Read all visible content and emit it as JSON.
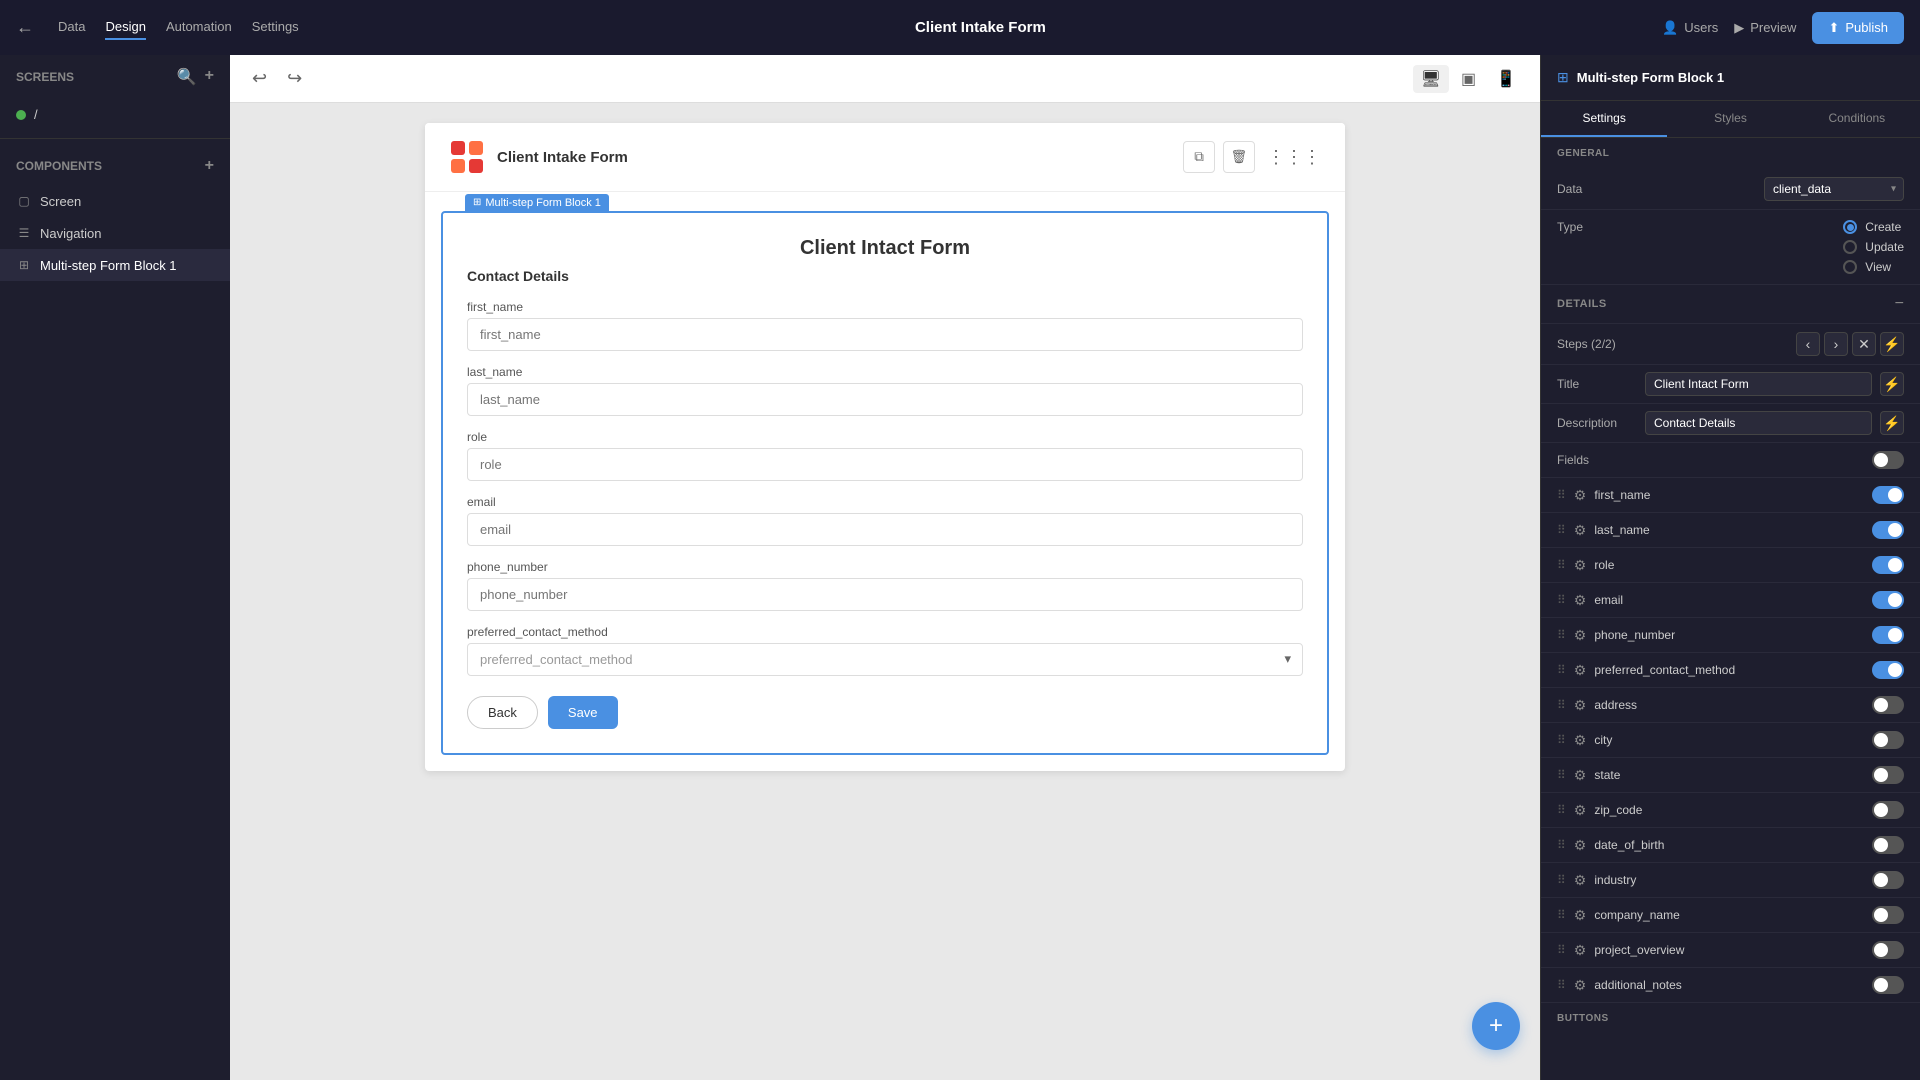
{
  "topbar": {
    "back_icon": "←",
    "nav_items": [
      {
        "label": "Data",
        "active": false
      },
      {
        "label": "Design",
        "active": true
      },
      {
        "label": "Automation",
        "active": false
      },
      {
        "label": "Settings",
        "active": false
      }
    ],
    "title": "Client Intake Form",
    "actions": [
      {
        "label": "Users",
        "icon": "👤"
      },
      {
        "label": "Preview",
        "icon": "▶"
      },
      {
        "label": "Publish",
        "icon": "⬆"
      }
    ]
  },
  "left_sidebar": {
    "screens_label": "Screens",
    "screen_item": "/",
    "components_label": "Components",
    "component_items": [
      {
        "label": "Screen",
        "icon": "▢",
        "active": false
      },
      {
        "label": "Navigation",
        "icon": "☰",
        "active": false
      },
      {
        "label": "Multi-step Form Block 1",
        "icon": "⊞",
        "active": true
      }
    ]
  },
  "canvas": {
    "form_title": "Client Intact Form",
    "app_name": "Client Intake Form",
    "block_label": "Multi-step Form Block 1",
    "form_section": "Contact Details",
    "fields": [
      {
        "label": "first_name",
        "placeholder": "first_name",
        "type": "input"
      },
      {
        "label": "last_name",
        "placeholder": "last_name",
        "type": "input"
      },
      {
        "label": "role",
        "placeholder": "role",
        "type": "input"
      },
      {
        "label": "email",
        "placeholder": "email",
        "type": "input"
      },
      {
        "label": "phone_number",
        "placeholder": "phone_number",
        "type": "input"
      },
      {
        "label": "preferred_contact_method",
        "placeholder": "preferred_contact_method",
        "type": "select"
      }
    ],
    "btn_back": "Back",
    "btn_save": "Save",
    "fab_icon": "+"
  },
  "right_sidebar": {
    "header_title": "Multi-step Form Block 1",
    "tabs": [
      "Settings",
      "Styles",
      "Conditions"
    ],
    "general_label": "GENERAL",
    "data_label": "Data",
    "data_value": "client_data",
    "type_label": "Type",
    "type_options": [
      {
        "label": "Create",
        "checked": true
      },
      {
        "label": "Update",
        "checked": false
      },
      {
        "label": "View",
        "checked": false
      }
    ],
    "details_label": "DETAILS",
    "steps_label": "Steps (2/2)",
    "title_label": "Title",
    "title_value": "Client Intact Form",
    "description_label": "Description",
    "description_value": "Contact Details",
    "fields_label": "Fields",
    "field_items": [
      {
        "name": "first_name",
        "enabled": true
      },
      {
        "name": "last_name",
        "enabled": true
      },
      {
        "name": "role",
        "enabled": true
      },
      {
        "name": "email",
        "enabled": true
      },
      {
        "name": "phone_number",
        "enabled": true
      },
      {
        "name": "preferred_contact_method",
        "enabled": true
      },
      {
        "name": "address",
        "enabled": false
      },
      {
        "name": "city",
        "enabled": false
      },
      {
        "name": "state",
        "enabled": false
      },
      {
        "name": "zip_code",
        "enabled": false
      },
      {
        "name": "date_of_birth",
        "enabled": false
      },
      {
        "name": "industry",
        "enabled": false
      },
      {
        "name": "company_name",
        "enabled": false
      },
      {
        "name": "project_overview",
        "enabled": false
      },
      {
        "name": "additional_notes",
        "enabled": false
      }
    ],
    "buttons_label": "Buttons"
  }
}
